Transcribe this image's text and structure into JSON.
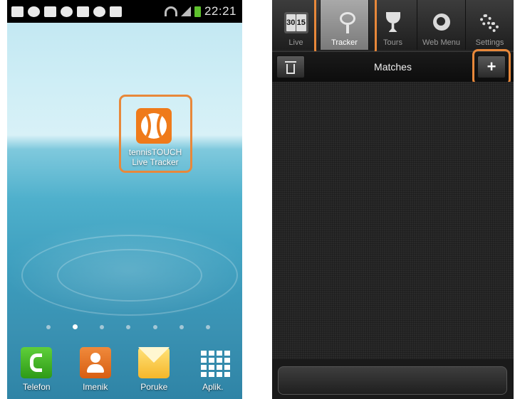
{
  "left_screen": {
    "status_bar": {
      "time": "22:21"
    },
    "home_app": {
      "label_line1": "tennisTOUCH",
      "label_line2": "Live Tracker",
      "icon": "tennis-ball-icon"
    },
    "page_dots": {
      "count": 7,
      "active_index": 1
    },
    "dock": [
      {
        "label": "Telefon",
        "icon": "phone-icon"
      },
      {
        "label": "Imenik",
        "icon": "contacts-icon"
      },
      {
        "label": "Poruke",
        "icon": "messages-icon"
      },
      {
        "label": "Aplik.",
        "icon": "apps-grid-icon"
      }
    ]
  },
  "right_screen": {
    "tabs": [
      {
        "label": "Live",
        "icon": "calendar-icon",
        "icon_text_a": "30",
        "icon_text_b": "15"
      },
      {
        "label": "Tracker",
        "icon": "racket-icon",
        "active": true
      },
      {
        "label": "Tours",
        "icon": "trophy-icon"
      },
      {
        "label": "Web Menu",
        "icon": "globe-icon"
      },
      {
        "label": "Settings",
        "icon": "gear-icon"
      }
    ],
    "header": {
      "title": "Matches",
      "add_label": "+",
      "trash_icon": "trash-icon"
    }
  },
  "colors": {
    "highlight": "#e8883a",
    "app_orange": "#ef7a1a"
  }
}
